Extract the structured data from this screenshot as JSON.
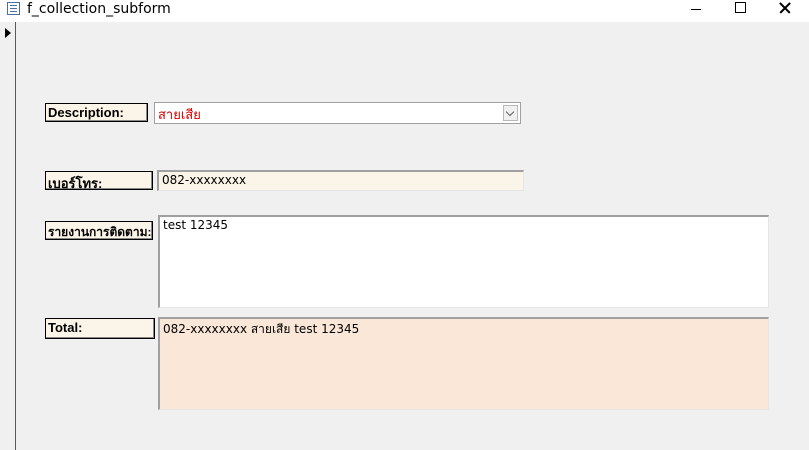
{
  "window": {
    "title": "f_collection_subform"
  },
  "form": {
    "description": {
      "label": "Description:",
      "value": "สายเสีย"
    },
    "phone": {
      "label": "เบอร์โทร:",
      "value": "082-xxxxxxxx"
    },
    "report": {
      "label": "รายงานการติดตาม:",
      "value": "test 12345"
    },
    "total": {
      "label": "Total:",
      "value": "082-xxxxxxxx สายเสีย test 12345"
    }
  },
  "colors": {
    "label_bg": "#fbf4e8",
    "combo_text": "#d40000",
    "total_bg": "#fae7d8"
  },
  "icons": [
    "form-icon",
    "minimize-icon",
    "maximize-icon",
    "close-icon",
    "record-pointer-icon",
    "dropdown-arrow-icon"
  ]
}
